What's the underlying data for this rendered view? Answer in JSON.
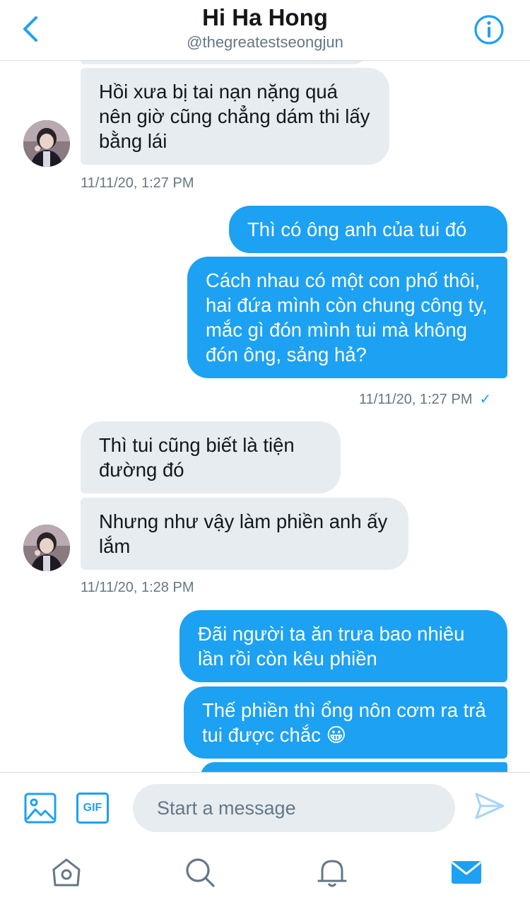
{
  "header": {
    "back_icon": "chevron-left-icon",
    "title": "Hi Ha Hong",
    "handle": "@thegreatestseongjun",
    "info_icon": "info-icon"
  },
  "messages": {
    "m1": "Hồi xưa bị tai nạn nặng quá nên giờ cũng chẳng dám thi lấy bằng lái",
    "t1": "11/11/20, 1:27 PM",
    "m2": "Thì có ông anh của tui đó",
    "m3": "Cách nhau có một con phố thôi, hai đứa mình còn chung công ty, mắc gì đón mình tui mà không đón ông, sảng hả?",
    "t2": "11/11/20, 1:27 PM",
    "t2_status": "✓",
    "m4": "Thì tui cũng biết là tiện đường đó",
    "m5": "Nhưng như vậy làm phiền anh ấy lắm",
    "t3": "11/11/20, 1:28 PM",
    "m6": "Đãi người ta ăn trưa bao nhiêu lần rồi còn kêu phiền",
    "m7": "Thế phiền thì ổng nôn cơm ra trả tui được chắc 😀"
  },
  "composer": {
    "image_icon": "image-icon",
    "gif_label": "GIF",
    "placeholder": "Start a message",
    "send_icon": "send-icon"
  },
  "tabbar": {
    "items": [
      "home-icon",
      "search-icon",
      "notifications-icon",
      "messages-icon"
    ]
  },
  "colors": {
    "accent": "#1da1f2",
    "incoming_bubble": "#e6ecf0",
    "secondary_text": "#657786"
  }
}
